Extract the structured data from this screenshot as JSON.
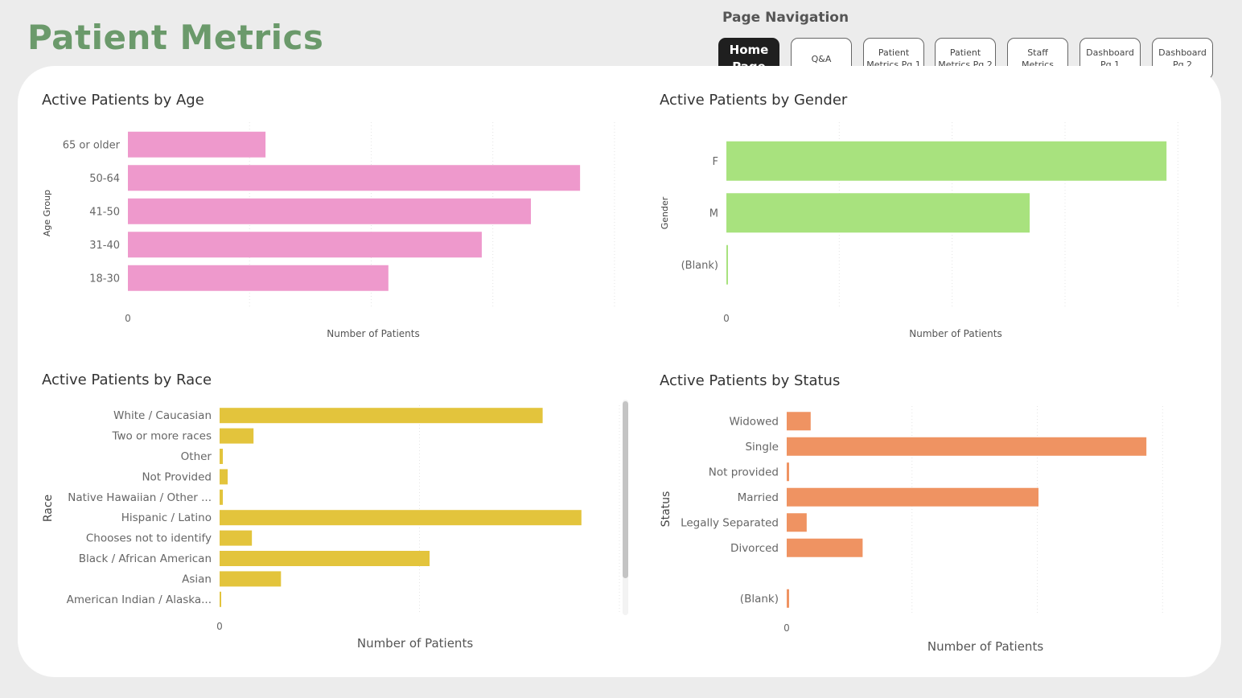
{
  "page": {
    "title": "Patient Metrics"
  },
  "nav": {
    "label": "Page Navigation",
    "buttons": [
      "Home Page",
      "Q&A",
      "Patient Metrics Pg 1",
      "Patient Metrics Pg 2",
      "Staff Metrics",
      "Dashboard Pg 1",
      "Dashboard Pg 2"
    ],
    "active_index": 0
  },
  "chart_data": [
    {
      "type": "bar",
      "orientation": "horizontal",
      "title": "Active Patients by Age",
      "xlabel": "Number of Patients",
      "ylabel": "Age Group",
      "x_tick_labels": [
        "0"
      ],
      "color": "#ee99cc",
      "categories": [
        "65 or older",
        "50-64",
        "41-50",
        "31-40",
        "18-30"
      ],
      "values": [
        28,
        92,
        82,
        72,
        53
      ],
      "xlim": [
        0,
        100
      ],
      "grid": true
    },
    {
      "type": "bar",
      "orientation": "horizontal",
      "title": "Active Patients by Gender",
      "xlabel": "Number of Patients",
      "ylabel": "Gender",
      "x_tick_labels": [
        "0"
      ],
      "color": "#a8e27e",
      "categories": [
        "F",
        "M",
        "(Blank)"
      ],
      "values": [
        193,
        133,
        0.5
      ],
      "xlim": [
        0,
        200
      ],
      "grid": true
    },
    {
      "type": "bar",
      "orientation": "horizontal",
      "title": "Active Patients by Race",
      "xlabel": "Number of Patients",
      "ylabel": "Race",
      "x_tick_labels": [
        "0"
      ],
      "color": "#e3c43c",
      "categories": [
        "White / Caucasian",
        "Two or more races",
        "Other",
        "Not Provided",
        "Native Hawaiian / Other ...",
        "Hispanic / Latino",
        "Chooses not to identify",
        "Black / African American",
        "Asian",
        "American Indian / Alaska..."
      ],
      "values": [
        100,
        10.5,
        1,
        2.5,
        1,
        112,
        10,
        65,
        19,
        0.5
      ],
      "xlim": [
        0,
        125
      ],
      "grid": true
    },
    {
      "type": "bar",
      "orientation": "horizontal",
      "title": "Active Patients by Status",
      "xlabel": "Number of Patients",
      "ylabel": "Status",
      "x_tick_labels": [
        "0"
      ],
      "color": "#ef9362",
      "categories": [
        "Widowed",
        "Single",
        "Not provided",
        "Married",
        "Legally Separated",
        "Divorced",
        "",
        "(Blank)"
      ],
      "values": [
        6,
        90,
        0.6,
        63,
        5,
        19,
        0,
        0.6
      ],
      "xlim": [
        0,
        95
      ],
      "grid": true
    }
  ]
}
